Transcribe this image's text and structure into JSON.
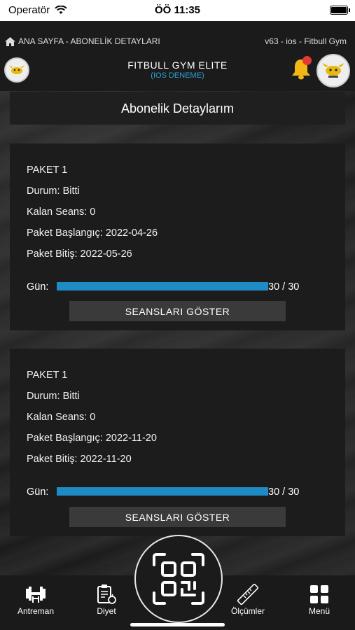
{
  "status_bar": {
    "carrier": "Operatör",
    "time": "ÖÖ 11:35"
  },
  "header": {
    "breadcrumb": "ANA SAYFA - ABONELİK DETAYLARI",
    "version": "v63 - ios -  Fitbull Gym",
    "gym_name": "FITBULL GYM ELITE",
    "gym_subtitle": "(IOS DENEME)",
    "notification_color": "#e53935",
    "accent": "#2aa0d8"
  },
  "page": {
    "title": "Abonelik Detaylarım"
  },
  "packages": [
    {
      "name": "PAKET 1",
      "status": "Durum: Bitti",
      "remaining": "Kalan Seans: 0",
      "start": "Paket Başlangıç: 2022-04-26",
      "end": "Paket Bitiş: 2022-05-26",
      "days_label": "Gün:",
      "days_progress": 1.0,
      "days_text": "30 / 30",
      "button": "SEANSLARI GÖSTER"
    },
    {
      "name": "PAKET 1",
      "status": "Durum: Bitti",
      "remaining": "Kalan Seans: 0",
      "start": "Paket Başlangıç: 2022-11-20",
      "end": "Paket Bitiş: 2022-11-20",
      "days_label": "Gün:",
      "days_progress": 1.0,
      "days_text": "30 / 30",
      "button": "SEANSLARI GÖSTER"
    }
  ],
  "nav": {
    "items": [
      {
        "label": "Antreman",
        "icon": "dumbbell-icon"
      },
      {
        "label": "Diyet",
        "icon": "clipboard-apple-icon"
      },
      {
        "label": "Ölçümler",
        "icon": "ruler-icon"
      },
      {
        "label": "Menü",
        "icon": "grid-icon"
      }
    ],
    "center_icon": "qr-scan-icon"
  }
}
